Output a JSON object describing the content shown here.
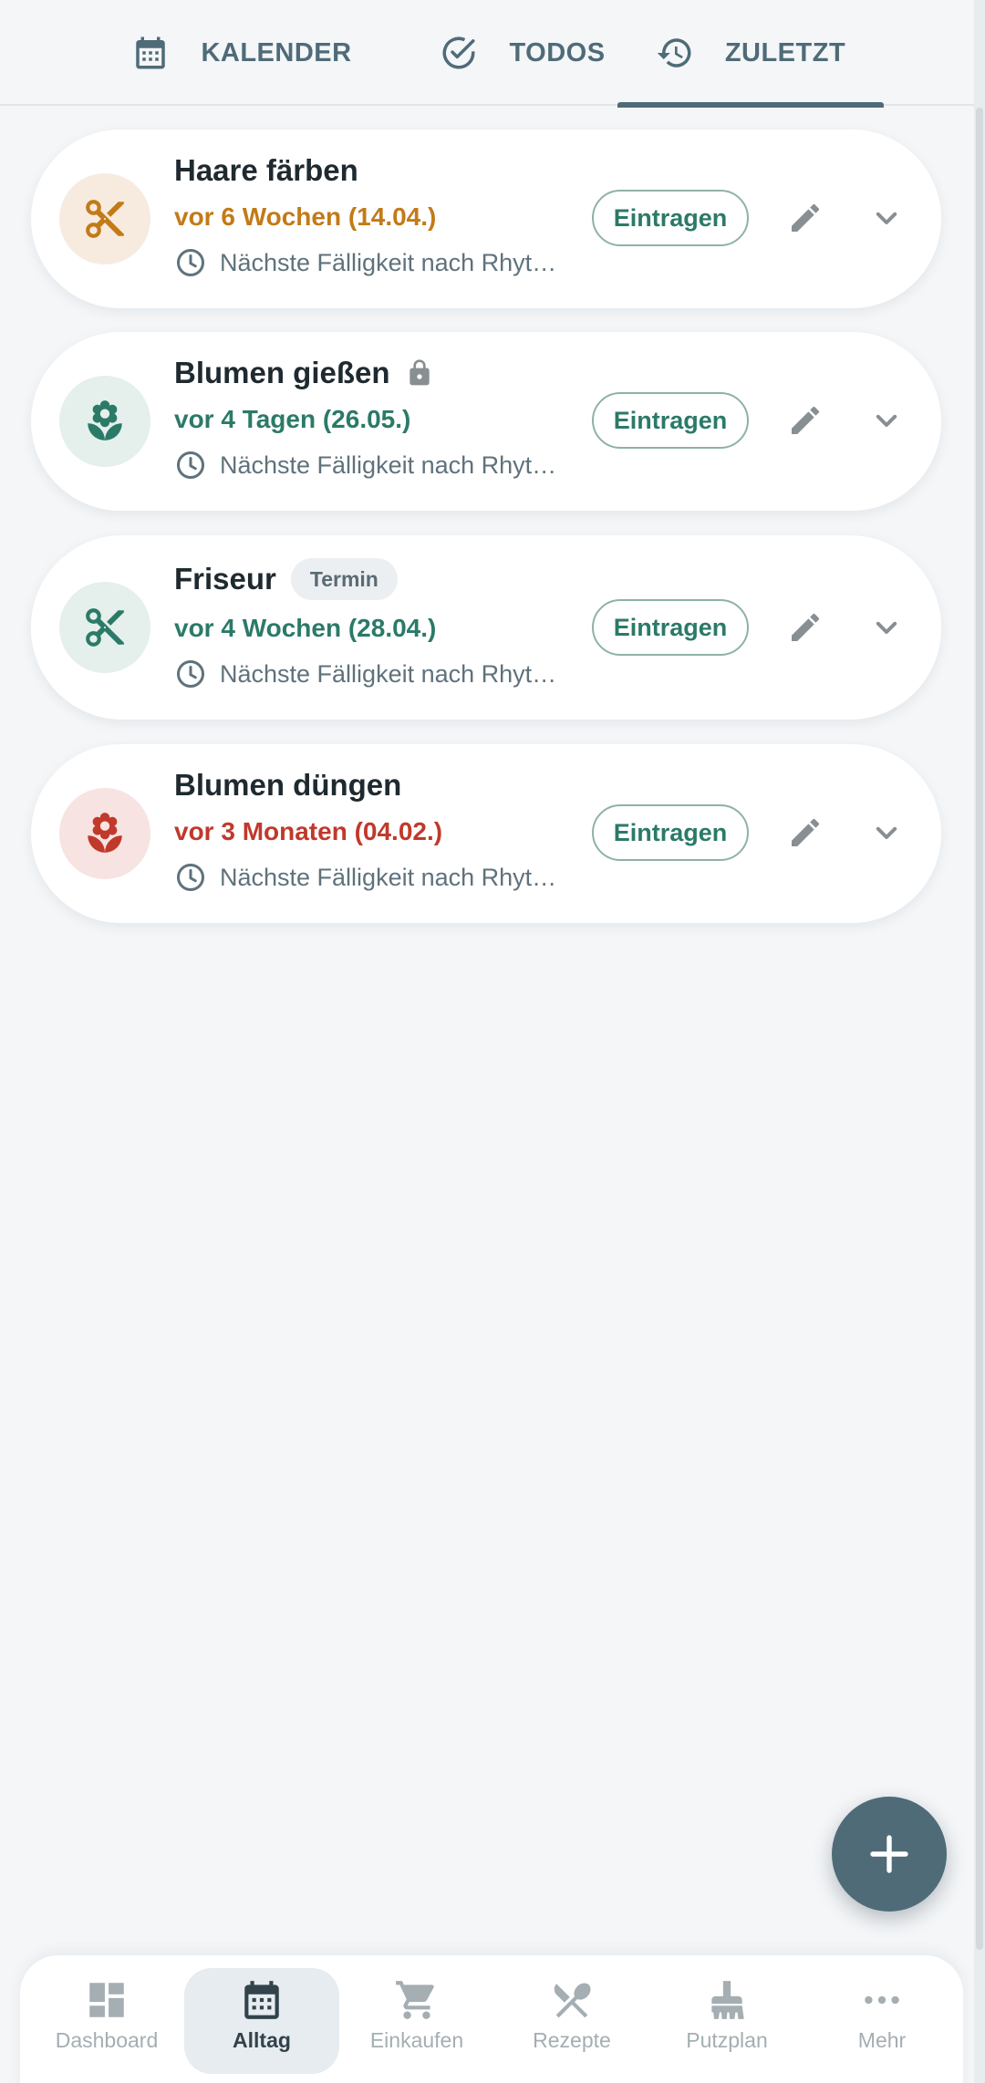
{
  "tabs": [
    {
      "label": "KALENDER",
      "icon": "calendar-icon",
      "active": false
    },
    {
      "label": "TODOS",
      "icon": "check-circle-icon",
      "active": false
    },
    {
      "label": "ZULETZT",
      "icon": "history-icon",
      "active": true
    }
  ],
  "entries": [
    {
      "title": "Haare färben",
      "ago": "vor 6 Wochen (14.04.)",
      "ago_color": "#c37a17",
      "icon": "scissors-icon",
      "icon_color": "#c37a17",
      "avatar_bg": "#f7ebe0",
      "next": "Nächste Fälligkeit nach Rhythmus",
      "badge": null,
      "locked": false
    },
    {
      "title": "Blumen gießen",
      "ago": "vor 4 Tagen (26.05.)",
      "ago_color": "#2b7a68",
      "icon": "flower-icon",
      "icon_color": "#2b7a68",
      "avatar_bg": "#e5efec",
      "next": "Nächste Fälligkeit nach Rhythmus",
      "badge": null,
      "locked": true
    },
    {
      "title": "Friseur",
      "ago": "vor 4 Wochen (28.04.)",
      "ago_color": "#2b7a68",
      "icon": "scissors-icon",
      "icon_color": "#2b7a68",
      "avatar_bg": "#e5efec",
      "next": "Nächste Fälligkeit nach Rhythmus",
      "badge": "Termin",
      "locked": false
    },
    {
      "title": "Blumen düngen",
      "ago": "vor 3 Monaten (04.02.)",
      "ago_color": "#c0392b",
      "icon": "flower-icon",
      "icon_color": "#c0392b",
      "avatar_bg": "#f7e3e1",
      "next": "Nächste Fälligkeit nach Rhythmus",
      "badge": null,
      "locked": false
    }
  ],
  "actions": {
    "entry_label": "Eintragen"
  },
  "bottom_nav": [
    {
      "label": "Dashboard",
      "icon": "dashboard-icon",
      "active": false
    },
    {
      "label": "Alltag",
      "icon": "calendar-icon",
      "active": true
    },
    {
      "label": "Einkaufen",
      "icon": "cart-icon",
      "active": false
    },
    {
      "label": "Rezepte",
      "icon": "utensils-icon",
      "active": false
    },
    {
      "label": "Putzplan",
      "icon": "broom-icon",
      "active": false
    },
    {
      "label": "Mehr",
      "icon": "more-icon",
      "active": false
    }
  ],
  "colors": {
    "primary": "#4f6b78",
    "accent_green": "#2b7a68",
    "background": "#f4f6f8"
  }
}
